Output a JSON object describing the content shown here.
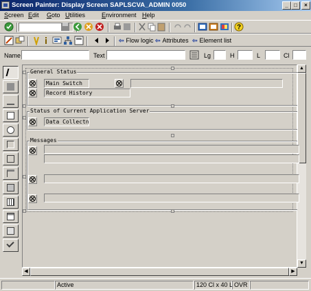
{
  "window": {
    "title": "Screen Painter: Display Screen SAPLSCVA_ADMIN 0050",
    "controls": [
      "_",
      "□",
      "×"
    ]
  },
  "menu": [
    "Screen",
    "Edit",
    "Goto",
    "Utilities",
    "Environment",
    "Help"
  ],
  "toolbar2": {
    "flow_logic": "Flow logic",
    "attributes": "Attributes",
    "element_list": "Element list"
  },
  "attributes": {
    "name_label": "Name",
    "name_value": "",
    "text_label": "Text",
    "text_value": "",
    "lg_label": "Lg",
    "h_label": "H",
    "l_label": "L",
    "cl_label": "Cl"
  },
  "screen": {
    "general_status": {
      "title": "General Status",
      "main_switch": "Main Switch",
      "record_history": "Record History"
    },
    "app_server": {
      "title": "Status of Current Application Server",
      "data_collection": "Data Collectn"
    },
    "messages": {
      "title": "Messages"
    }
  },
  "statusbar": {
    "state": "Active",
    "size": "120 Cl x 40 L",
    "mode": "OVR"
  },
  "colors": {
    "title_start": "#0a246a",
    "title_end": "#a6caf0",
    "face": "#d4d0c8"
  }
}
